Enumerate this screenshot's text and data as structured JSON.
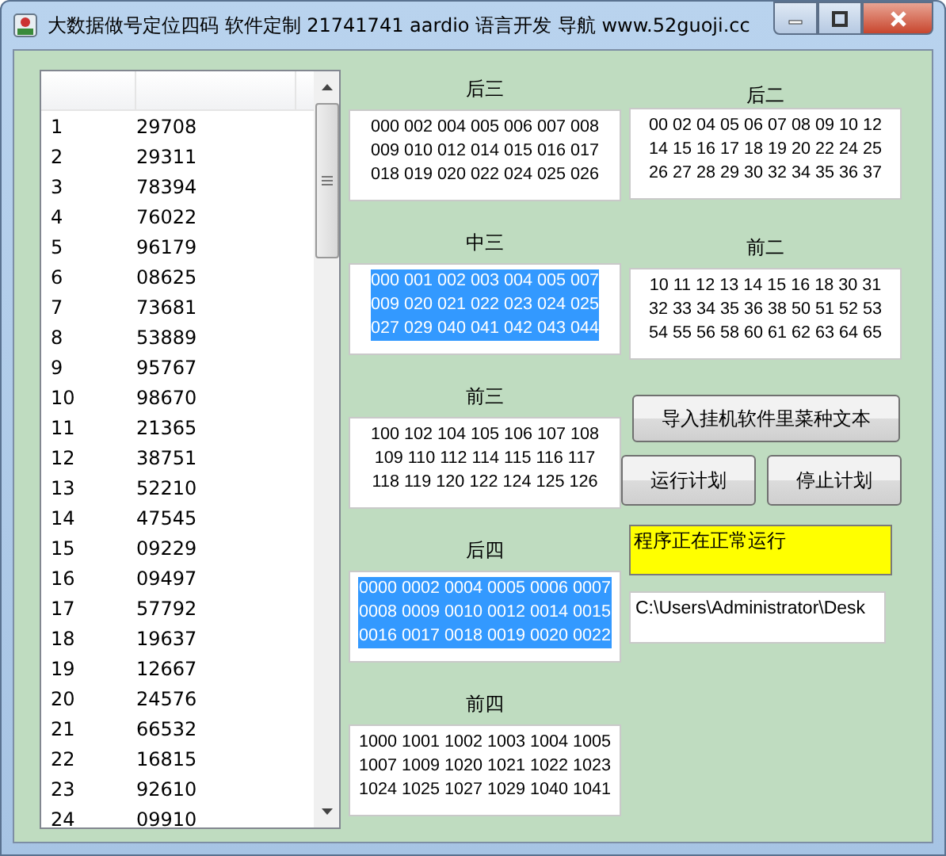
{
  "window": {
    "title": "大数据做号定位四码 软件定制 21741741 aardio 语言开发 导航 www.52guoji.cc"
  },
  "table": {
    "rows": [
      {
        "index": "1",
        "value": "29708"
      },
      {
        "index": "2",
        "value": "29311"
      },
      {
        "index": "3",
        "value": "78394"
      },
      {
        "index": "4",
        "value": "76022"
      },
      {
        "index": "5",
        "value": "96179"
      },
      {
        "index": "6",
        "value": "08625"
      },
      {
        "index": "7",
        "value": "73681"
      },
      {
        "index": "8",
        "value": "53889"
      },
      {
        "index": "9",
        "value": "95767"
      },
      {
        "index": "10",
        "value": "98670"
      },
      {
        "index": "11",
        "value": "21365"
      },
      {
        "index": "12",
        "value": "38751"
      },
      {
        "index": "13",
        "value": "52210"
      },
      {
        "index": "14",
        "value": "47545"
      },
      {
        "index": "15",
        "value": "09229"
      },
      {
        "index": "16",
        "value": "09497"
      },
      {
        "index": "17",
        "value": "57792"
      },
      {
        "index": "18",
        "value": "19637"
      },
      {
        "index": "19",
        "value": "12667"
      },
      {
        "index": "20",
        "value": "24576"
      },
      {
        "index": "21",
        "value": "66532"
      },
      {
        "index": "22",
        "value": "16815"
      },
      {
        "index": "23",
        "value": "92610"
      },
      {
        "index": "24",
        "value": "09910"
      }
    ]
  },
  "middle_groups": [
    {
      "label": "后三",
      "selected": false,
      "lines": [
        "000 002 004 005 006 007 008",
        "009 010 012 014 015 016 017",
        "018 019 020 022 024 025 026"
      ]
    },
    {
      "label": "中三",
      "selected": true,
      "lines": [
        "000 001 002 003 004 005 007",
        "009 020 021 022 023 024 025",
        "027 029 040 041 042 043 044"
      ]
    },
    {
      "label": "前三",
      "selected": false,
      "lines": [
        "100 102 104 105 106 107 108",
        "109 110 112 114 115 116 117",
        "118 119 120 122 124 125 126"
      ]
    },
    {
      "label": "后四",
      "selected": true,
      "lines": [
        "0000 0002 0004 0005 0006 0007",
        "0008 0009 0010 0012 0014 0015",
        "0016 0017 0018 0019 0020 0022"
      ]
    },
    {
      "label": "前四",
      "selected": false,
      "lines": [
        "1000 1001 1002 1003 1004 1005",
        "1007 1009 1020 1021 1022 1023",
        "1024 1025 1027 1029 1040 1041"
      ]
    }
  ],
  "right_groups": [
    {
      "label": "后二",
      "selected": false,
      "lines": [
        "00 02 04 05 06 07 08 09 10 12",
        "14 15 16 17 18 19 20 22 24 25",
        "26 27 28 29 30 32 34 35 36 37"
      ]
    },
    {
      "label": "前二",
      "selected": false,
      "lines": [
        "10 11 12 13 14 15 16 18 30 31",
        "32 33 34 35 36 38 50 51 52 53",
        "54 55 56 58 60 61 62 63 64 65"
      ]
    }
  ],
  "import_button": "导入挂机软件里菜种文本",
  "plan_buttons": [
    "运行计划",
    "停止计划"
  ],
  "status_field": {
    "value": "程序正在正常运行"
  },
  "path_field": {
    "value": "C:\\Users\\Administrator\\Desk"
  }
}
